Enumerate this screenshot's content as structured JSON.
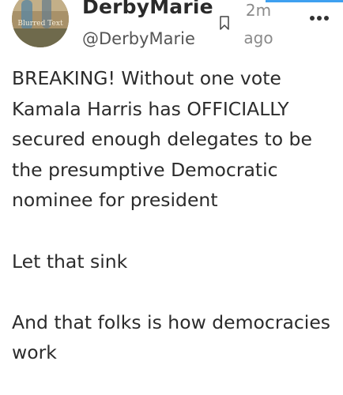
{
  "post": {
    "display_name": "DerbyMarie",
    "handle": "@DerbyMarie",
    "timestamp": "2m ago",
    "body": "BREAKING! Without one vote Kamala Harris has OFFICIALLY secured enough delegates to be the presumptive Democratic nominee for president\n\nLet that sink\n\nAnd that folks is how democracies work",
    "avatar_text": "Blurred Text"
  },
  "icons": {
    "bookmark": "bookmark-icon",
    "more": "more-options-icon"
  },
  "colors": {
    "accent": "#3ea0f0",
    "text": "#2b2b2b",
    "muted": "#8a8a8a"
  }
}
